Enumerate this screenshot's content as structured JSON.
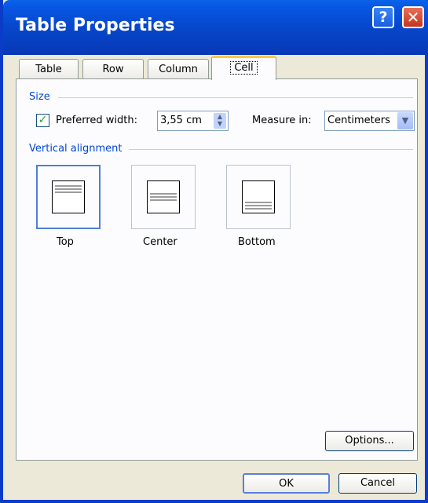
{
  "window": {
    "title": "Table Properties",
    "help_symbol": "?",
    "close_symbol": "✕"
  },
  "tabs": [
    {
      "label": "Table",
      "active": false
    },
    {
      "label": "Row",
      "active": false
    },
    {
      "label": "Column",
      "active": false
    },
    {
      "label": "Cell",
      "active": true
    }
  ],
  "size_group": {
    "label": "Size",
    "preferred_width_label": "Preferred width:",
    "preferred_width_checked": true,
    "preferred_width_value": "3,55 cm",
    "measure_in_label": "Measure in:",
    "measure_in_value": "Centimeters"
  },
  "vertical_alignment": {
    "label": "Vertical alignment",
    "options": [
      {
        "label": "Top",
        "selected": true
      },
      {
        "label": "Center",
        "selected": false
      },
      {
        "label": "Bottom",
        "selected": false
      }
    ]
  },
  "buttons": {
    "options": "Options...",
    "ok": "OK",
    "cancel": "Cancel"
  },
  "colors": {
    "title_bar": "#0a58e0",
    "dialog_bg": "#ece9d8",
    "group_label": "#0046d5",
    "active_tab_accent": "#ffc83c"
  }
}
